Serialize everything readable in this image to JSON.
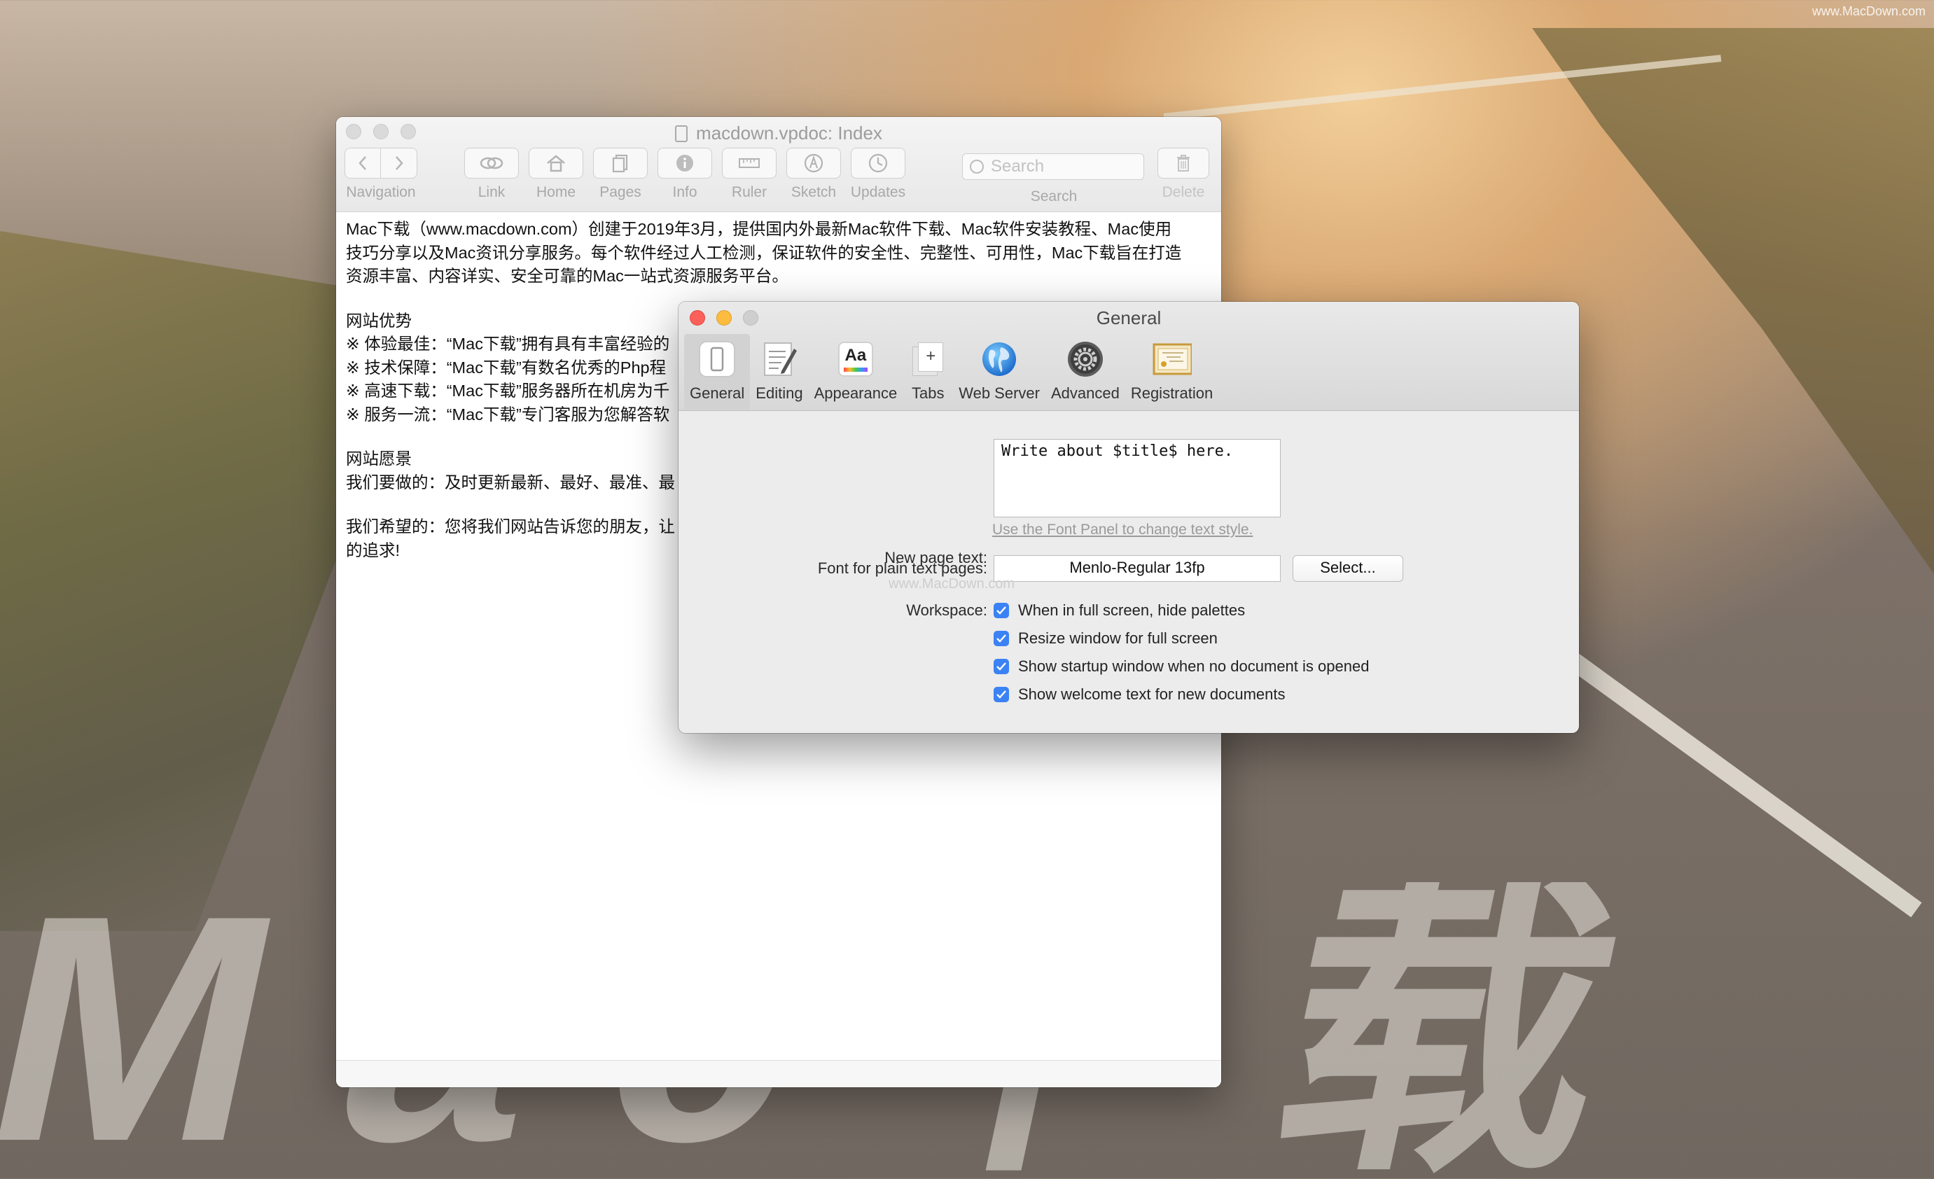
{
  "watermark": "www.MacDown.com",
  "doc_window": {
    "title": "macdown.vpdoc: Index",
    "toolbar": {
      "navigation_label": "Navigation",
      "link_label": "Link",
      "home_label": "Home",
      "pages_label": "Pages",
      "info_label": "Info",
      "ruler_label": "Ruler",
      "sketch_label": "Sketch",
      "updates_label": "Updates",
      "search_placeholder": "Search",
      "search_label": "Search",
      "delete_label": "Delete"
    },
    "content": {
      "intro_line1": "Mac下载（www.macdown.com）创建于2019年3月，提供国内外最新Mac软件下载、Mac软件安装教程、Mac使用",
      "intro_line2": "技巧分享以及Mac资讯分享服务。每个软件经过人工检测，保证软件的安全性、完整性、可用性，Mac下载旨在打造",
      "intro_line3": "资源丰富、内容详实、安全可靠的Mac一站式资源服务平台。",
      "advantages_heading": "网站优势",
      "adv1": "※ 体验最佳：“Mac下载”拥有具有丰富经验的",
      "adv2": "※ 技术保障：“Mac下载”有数名优秀的Php程",
      "adv3": "※ 高速下载：“Mac下载”服务器所在机房为千",
      "adv4": "※ 服务一流：“Mac下载”专门客服为您解答软",
      "vision_heading": "网站愿景",
      "vision1": "我们要做的：及时更新最新、最好、最准、最",
      "hope1": "我们希望的：您将我们网站告诉您的朋友，让",
      "hope2": "的追求!"
    }
  },
  "pref_window": {
    "title": "General",
    "tabs": [
      {
        "label": "General",
        "icon": "general-icon"
      },
      {
        "label": "Editing",
        "icon": "editing-icon"
      },
      {
        "label": "Appearance",
        "icon": "appearance-icon"
      },
      {
        "label": "Tabs",
        "icon": "tabs-icon"
      },
      {
        "label": "Web Server",
        "icon": "globe-icon"
      },
      {
        "label": "Advanced",
        "icon": "gear-icon"
      },
      {
        "label": "Registration",
        "icon": "certificate-icon"
      }
    ],
    "appearance_icon_text": "Aa",
    "tabs_icon_text": "+",
    "new_page_label": "New page text:",
    "new_page_value": "Write about $title$ here.",
    "font_panel_link": "Use the Font Panel to change text style.",
    "font_label": "Font for plain text pages:",
    "font_value": "Menlo-Regular 13fp",
    "select_button": "Select...",
    "workspace_label": "Workspace:",
    "checkboxes": [
      {
        "label": "When in full screen, hide palettes",
        "checked": true
      },
      {
        "label": "Resize window for full screen",
        "checked": true
      },
      {
        "label": "Show startup window when no document is opened",
        "checked": true
      },
      {
        "label": "Show welcome text for new documents",
        "checked": true
      }
    ]
  },
  "background": {
    "road_text": "Mac下载"
  },
  "colors": {
    "checkbox_blue": "#3b82f5",
    "close_red": "#fc605b",
    "minimize_yellow": "#fdbc40"
  }
}
